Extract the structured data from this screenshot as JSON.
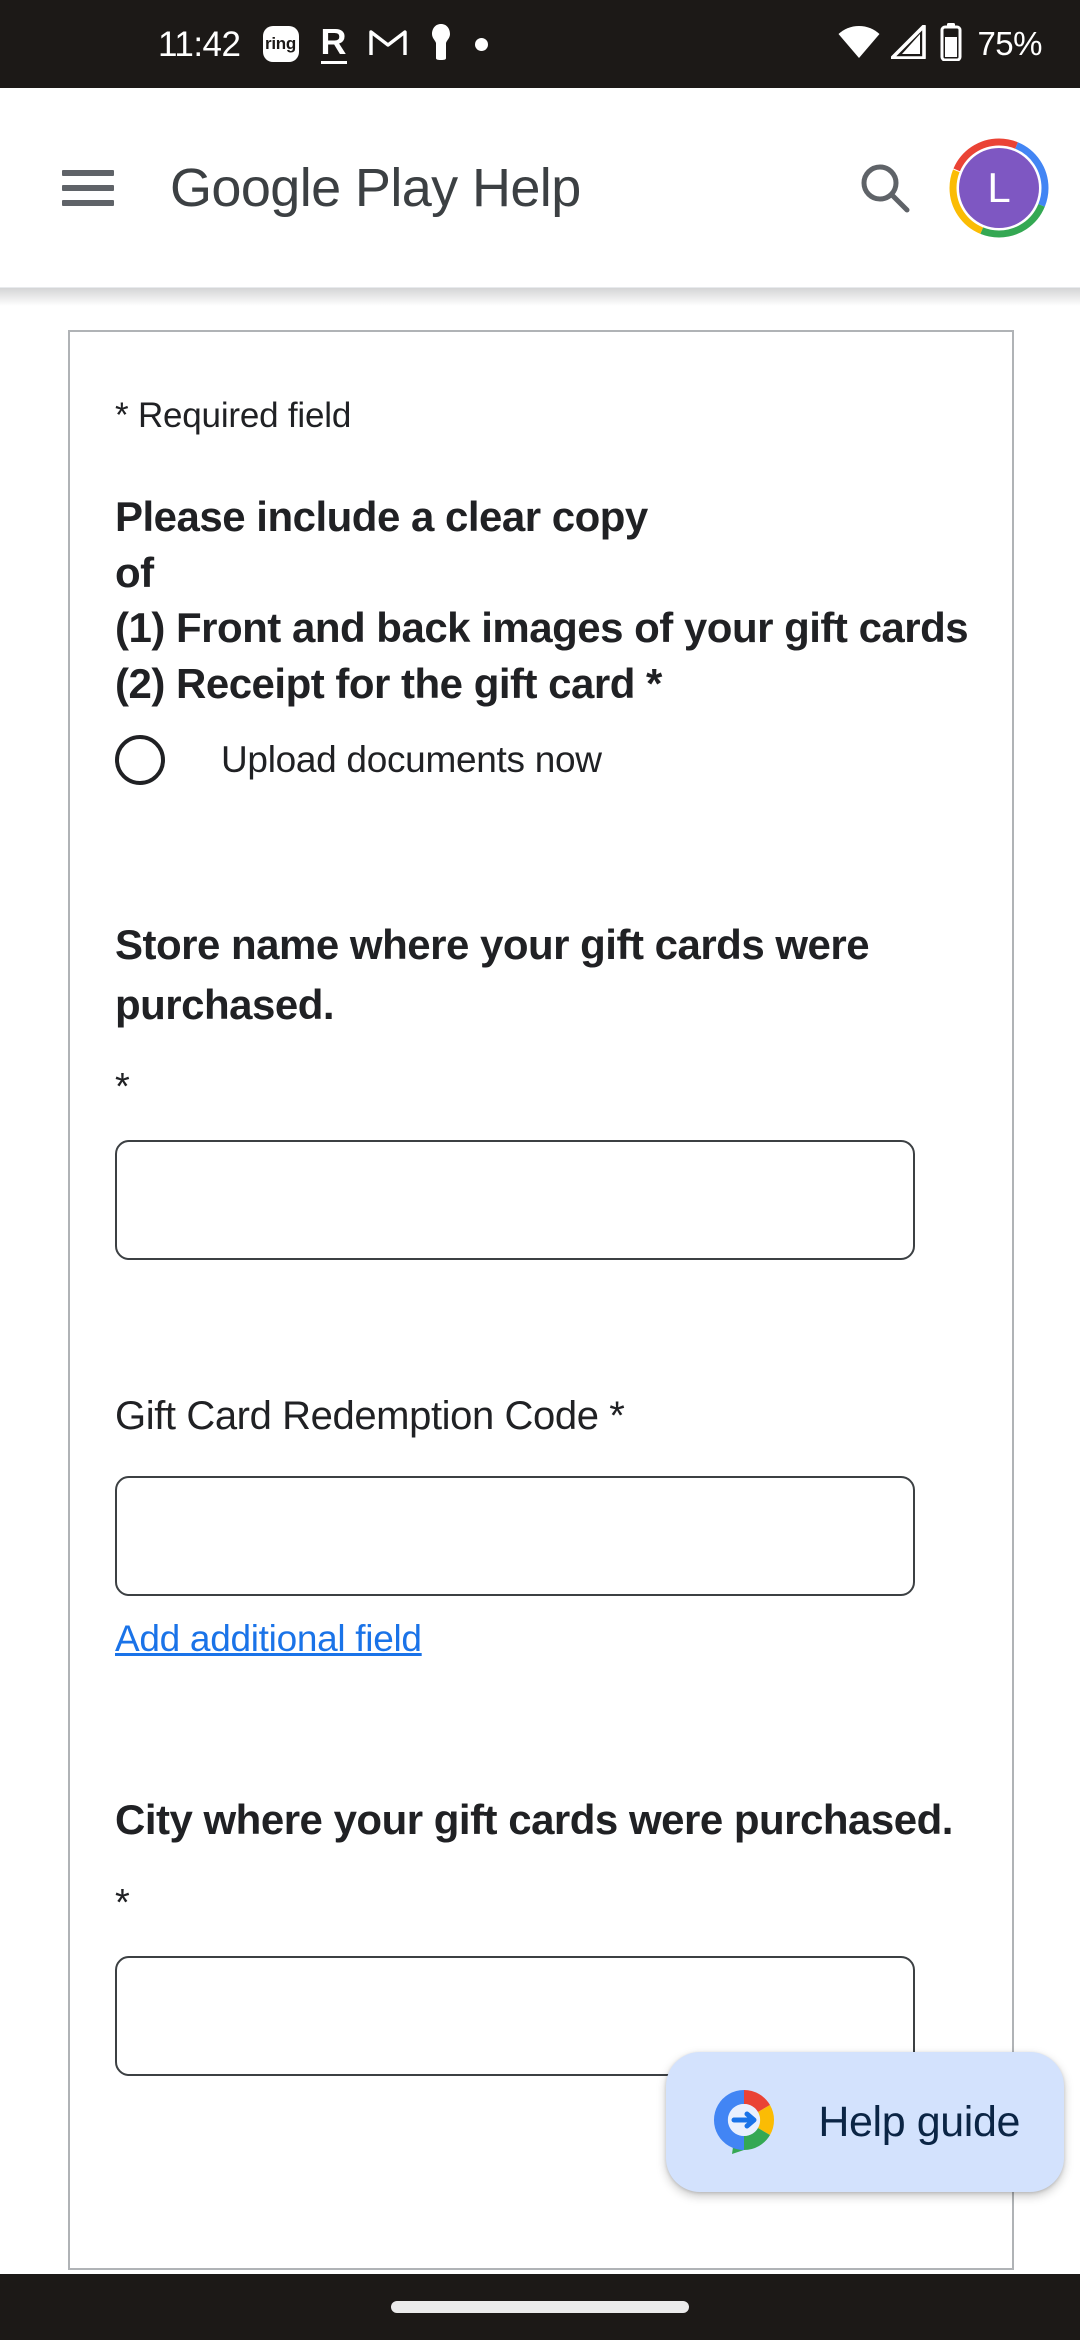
{
  "status_bar": {
    "time": "11:42",
    "battery_percent": "75%",
    "left_icons": [
      "ring-app-icon",
      "reddit-icon",
      "gmail-icon",
      "keep-notes-icon",
      "dot-icon"
    ],
    "right_icons": [
      "wifi-icon",
      "cellular-signal-icon",
      "battery-icon"
    ],
    "background_color": "#1c1917"
  },
  "app_bar": {
    "title": "Google Play Help",
    "menu_icon": "hamburger-menu-icon",
    "search_icon": "search-icon",
    "avatar_initial": "L",
    "avatar_color": "#7e57c2",
    "ring_colors": {
      "red": "#ea4335",
      "blue": "#4285f4",
      "green": "#34a853",
      "yellow": "#fbbc04"
    }
  },
  "form": {
    "required_note": "* Required field",
    "instruction_lines": [
      "Please include a clear copy",
      "of",
      "(1) Front and back images of your gift cards",
      "(2) Receipt for the gift card *"
    ],
    "upload_option": {
      "label": "Upload documents now",
      "selected": false
    },
    "fields": [
      {
        "label": "Store name where your gift cards were purchased.",
        "required_marker": "*",
        "value": "",
        "placeholder": "",
        "bold_label": true,
        "add_field_link": ""
      },
      {
        "label": "Gift Card Redemption Code *",
        "required_marker": "",
        "value": "",
        "placeholder": "",
        "bold_label": false,
        "add_field_link": "Add additional field"
      },
      {
        "label": "City where your gift cards were purchased.",
        "required_marker": "*",
        "value": "",
        "placeholder": "",
        "bold_label": true,
        "add_field_link": ""
      }
    ]
  },
  "help_fab": {
    "label": "Help guide",
    "icon": "google-help-guide-icon",
    "background_color": "#d3e2fd",
    "text_color": "#0b2545"
  },
  "nav_bar": {
    "gesture_pill": "home-gesture-pill"
  },
  "colors": {
    "link_blue": "#1a73e8",
    "text_primary": "#202124",
    "card_border": "#b0b3b6"
  }
}
